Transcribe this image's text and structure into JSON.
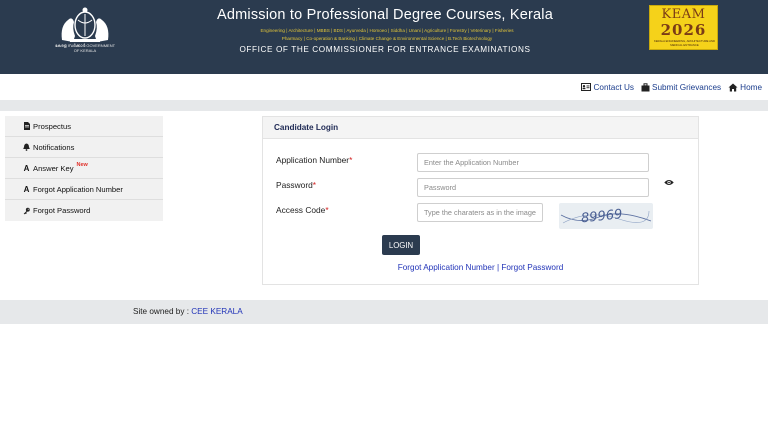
{
  "header": {
    "emblem_caption": "കേരള സർക്കാർ GOVERNMENT OF KERALA",
    "title": "Admission to Professional Degree Courses, Kerala",
    "courses_line1": "Engineering | Architecture | MBBS | BDS | Ayurveda | Homoeo | Siddha | Unani | Agriculture | Forestry | Veterinary | Fisheries",
    "courses_line2": "Pharmacy | Co-operation & Banking | Climate Change & Environmental Science | B.Tech Biotechnology",
    "office": "OFFICE OF THE COMMISSIONER FOR ENTRANCE EXAMINATIONS",
    "logo": {
      "name": "KEAM",
      "year": "2026",
      "subtitle": "KERALA ENGINEERING, ARCHITECTURE AND MEDICAL ENTRANCE"
    }
  },
  "topnav": {
    "contact": "Contact Us",
    "grievances": "Submit Grievances",
    "home": "Home"
  },
  "sidebar": {
    "items": [
      {
        "label": "Prospectus",
        "icon": "document-icon"
      },
      {
        "label": "Notifications",
        "icon": "bell-icon"
      },
      {
        "label": "Answer Key",
        "icon": "letter-a-icon",
        "badge": "New"
      },
      {
        "label": "Forgot Application Number",
        "icon": "letter-a-icon"
      },
      {
        "label": "Forgot Password",
        "icon": "key-icon"
      }
    ]
  },
  "login": {
    "heading": "Candidate Login",
    "app_number_label": "Application Number",
    "app_number_placeholder": "Enter the Application Number",
    "password_label": "Password",
    "password_placeholder": "Password",
    "access_code_label": "Access Code",
    "access_code_placeholder": "Type the charaters as in the image",
    "required_mark": "*",
    "captcha_text": "89969",
    "login_button": "LOGIN",
    "forgot_app_link": "Forgot Application Number",
    "separator": " | ",
    "forgot_pw_link": "Forgot Password"
  },
  "footer": {
    "prefix": "Site owned by : ",
    "owner_link": "CEE KERALA"
  },
  "colors": {
    "header_bg": "#2b3b4f",
    "subline": "#e2c53a",
    "link": "#2234b8",
    "required": "#d21f1f",
    "logo_bg": "#f5d21a"
  }
}
